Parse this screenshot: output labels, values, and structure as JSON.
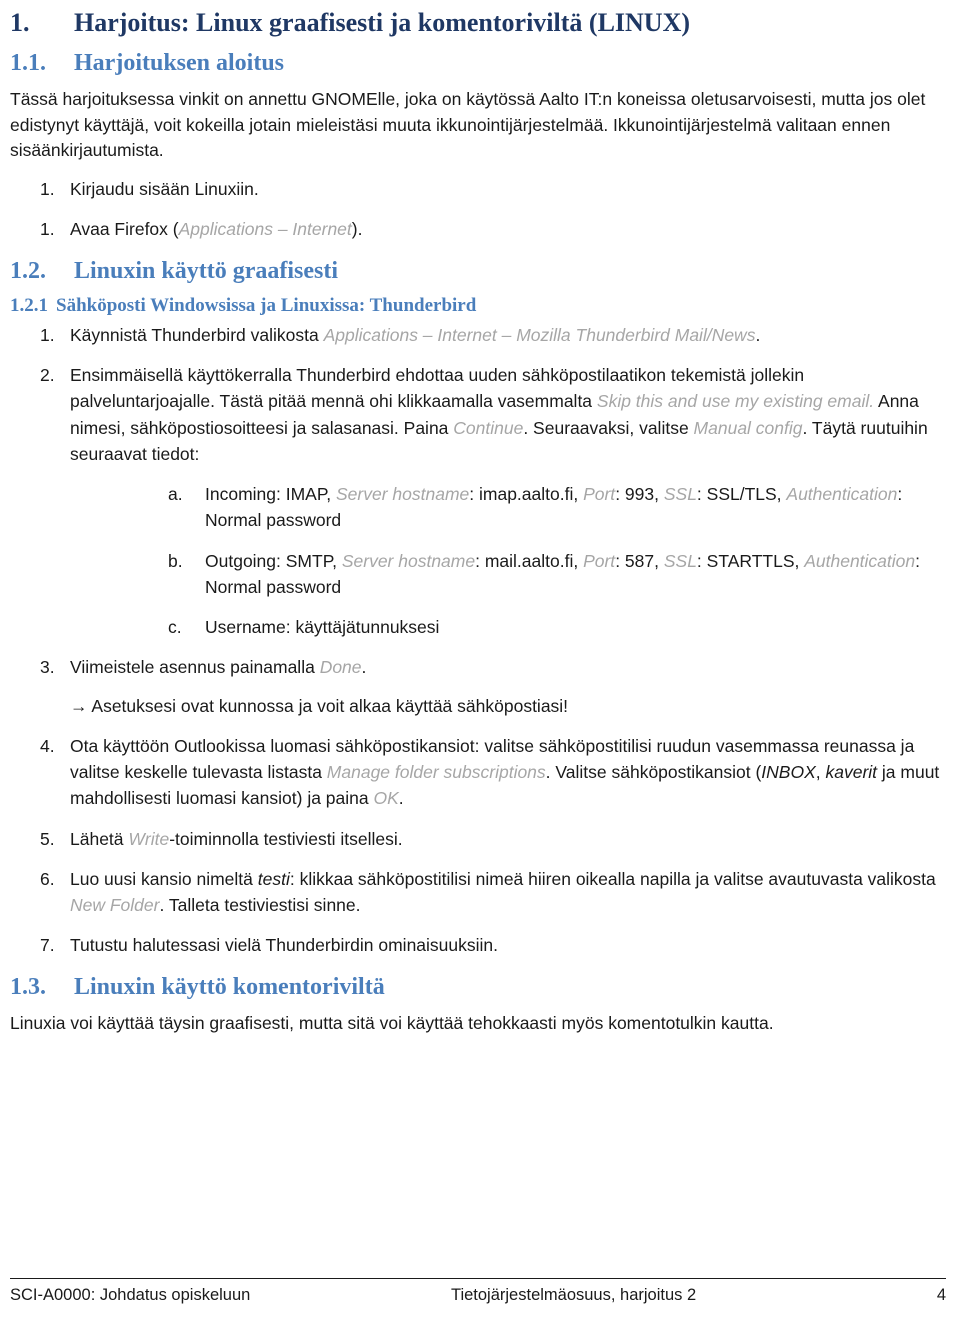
{
  "document": {
    "heading1": {
      "number": "1.",
      "title": "Harjoitus: Linux graafisesti ja komentoriviltä (LINUX)"
    },
    "section_1_1": {
      "number": "1.1.",
      "title": "Harjoituksen aloitus",
      "intro": "Tässä harjoituksessa vinkit on annettu GNOMElle, joka on käytössä Aalto IT:n koneissa oletusarvoisesti, mutta jos olet edistynyt käyttäjä, voit kokeilla jotain mieleistäsi muuta ikkunointijärjestelmää. Ikkunointijärjestelmä valitaan ennen sisäänkirjautumista.",
      "item1": {
        "marker": "1.",
        "text": "Kirjaudu sisään Linuxiin."
      },
      "item2": {
        "marker": "1.",
        "text_before": "Avaa Firefox (",
        "ui_italic": "Applications – Internet",
        "text_after": ")."
      }
    },
    "section_1_2": {
      "number": "1.2.",
      "title": "Linuxin käyttö graafisesti"
    },
    "section_1_2_1": {
      "number": "1.2.1",
      "title": "Sähköposti Windowsissa ja Linuxissa: Thunderbird",
      "item1": {
        "marker": "1.",
        "text_before": "Käynnistä Thunderbird valikosta ",
        "ui_italic": "Applications – Internet – Mozilla Thunderbird Mail/News",
        "text_after": "."
      },
      "item2": {
        "marker": "2.",
        "seg1": "Ensimmäisellä käyttökerralla Thunderbird ehdottaa uuden sähköpostilaatikon tekemistä jollekin palveluntarjoajalle. Tästä pitää mennä ohi klikkaamalla vasemmalta ",
        "ui1": "Skip this and use my existing email.",
        "seg2": " Anna nimesi, sähköpostiosoitteesi ja salasanasi. Paina ",
        "ui2": "Continue",
        "seg3": ". Seuraavaksi, valitse ",
        "ui3": "Manual config",
        "seg4": ". Täytä ruutuihin seuraavat tiedot:"
      },
      "sub_a": {
        "marker": "a.",
        "seg1": "Incoming: IMAP, ",
        "ui1": "Server hostname",
        "seg2": ": imap.aalto.fi, ",
        "ui2": "Port",
        "seg3": ": 993, ",
        "ui3": "SSL",
        "seg4": ": SSL/TLS, ",
        "ui4": "Authentication",
        "seg5": ": Normal password"
      },
      "sub_b": {
        "marker": "b.",
        "seg1": "Outgoing: SMTP, ",
        "ui1": "Server hostname",
        "seg2": ": mail.aalto.fi, ",
        "ui2": "Port",
        "seg3": ": 587, ",
        "ui3": "SSL",
        "seg4": ": STARTTLS, ",
        "ui4": "Authentication",
        "seg5": ": Normal password"
      },
      "sub_c": {
        "marker": "c.",
        "text": "Username: käyttäjätunnuksesi"
      },
      "item3": {
        "marker": "3.",
        "text_before": "Viimeistele asennus painamalla ",
        "ui_italic": "Done",
        "text_after": ".",
        "note": "→ Asetuksesi ovat kunnossa ja voit alkaa käyttää sähköpostiasi!"
      },
      "item4": {
        "marker": "4.",
        "seg1": "Ota käyttöön Outlookissa luomasi sähköpostikansiot: valitse sähköpostitilisi ruudun vasemmassa reunassa ja valitse keskelle tulevasta listasta ",
        "ui1": "Manage folder subscriptions",
        "seg2": ". Valitse sähköpostikansiot (",
        "em1": "INBOX",
        "seg3": ", ",
        "em2": "kaverit",
        "seg4": " ja muut mahdollisesti luomasi kansiot) ja paina ",
        "ui2": "OK",
        "seg5": "."
      },
      "item5": {
        "marker": "5.",
        "text_before": "Lähetä ",
        "ui_italic": "Write",
        "text_after": "-toiminnolla testiviesti itsellesi."
      },
      "item6": {
        "marker": "6.",
        "seg1": "Luo uusi kansio nimeltä ",
        "em1": "testi",
        "seg2": ": klikkaa sähköpostitilisi nimeä hiiren oikealla napilla ja valitse avautuvasta valikosta ",
        "ui1": "New Folder",
        "seg3": ". Talleta testiviestisi sinne."
      },
      "item7": {
        "marker": "7.",
        "text": "Tutustu halutessasi vielä Thunderbirdin ominaisuuksiin."
      }
    },
    "section_1_3": {
      "number": "1.3.",
      "title": "Linuxin käyttö komentoriviltä",
      "body": "Linuxia voi käyttää täysin graafisesti, mutta sitä voi käyttää tehokkaasti myös komentotulkin kautta."
    },
    "footer": {
      "left": "SCI-A0000: Johdatus opiskeluun",
      "center": "Tietojärjestelmäosuus, harjoitus 2",
      "page": "4"
    },
    "colors": {
      "heading1": "#1f3864",
      "heading2": "#4a7ebb",
      "body": "#1a1a1a",
      "ui_italic": "#a6a6a6"
    }
  }
}
